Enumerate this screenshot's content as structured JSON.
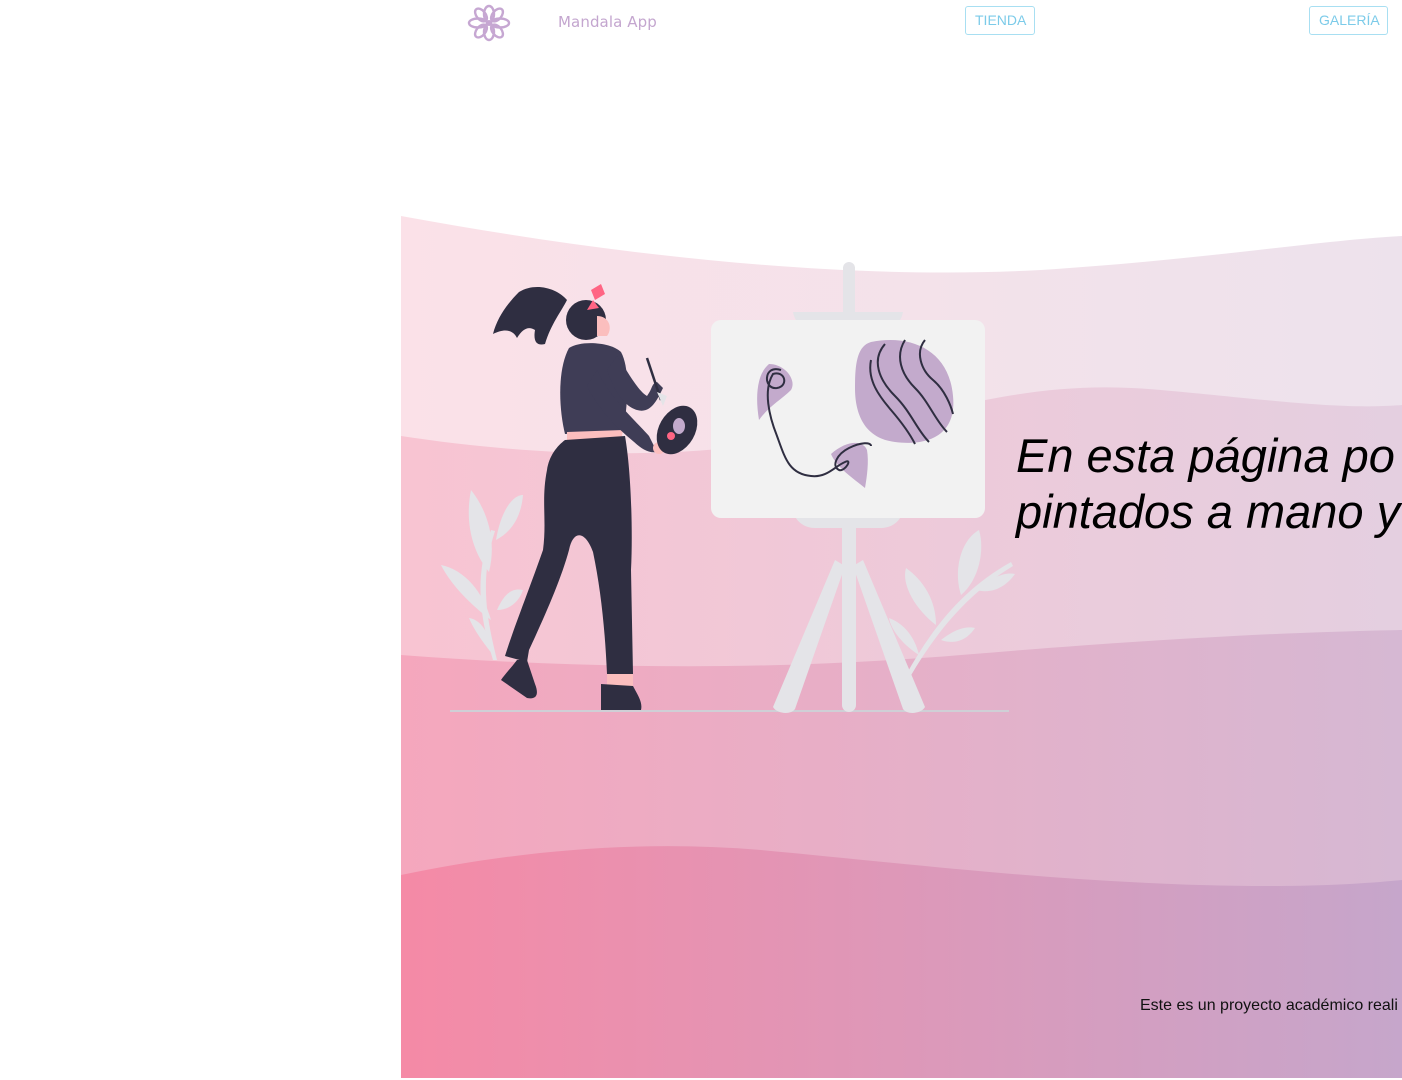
{
  "header": {
    "brand": "Mandala App",
    "logo_icon": "mandala-flower-icon",
    "nav": {
      "tienda_label": "TIENDA",
      "galeria_label": "GALERÍA"
    }
  },
  "hero": {
    "line1": "En esta página po",
    "line2": "pintados a mano y",
    "illustration": "woman-painting-easel-illustration"
  },
  "footer": {
    "note": "Este es un proyecto académico reali"
  },
  "colors": {
    "brand": "#c4a6cf",
    "nav_border": "#a8dff2",
    "nav_text": "#7ccbe9",
    "wave_pink": "#f48aa6",
    "wave_lavender": "#c4a6cc",
    "figure_dark": "#2f2e41",
    "accent_purple": "#c3aacc"
  }
}
